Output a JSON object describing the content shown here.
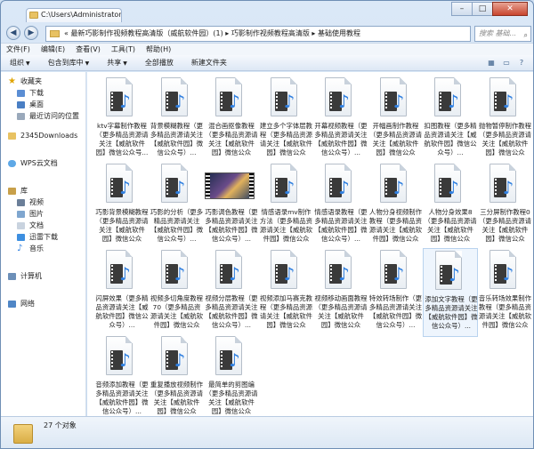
{
  "window": {
    "tab_title": "C:\\Users\\Administrator\\",
    "controls": [
      "–",
      "□",
      "✕"
    ]
  },
  "address": {
    "path": "« 最新巧影制作视频教程高清版（威航软件园）(1) ▸ 巧影制作视频教程高清版 ▸ 基础使用教程",
    "search_placeholder": "搜索 基础..."
  },
  "menu": [
    "文件(F)",
    "编辑(E)",
    "查看(V)",
    "工具(T)",
    "帮助(H)"
  ],
  "toolbar": {
    "organize": "组织",
    "include": "包含到库中",
    "share": "共享",
    "play_all": "全部播放",
    "new_folder": "新建文件夹"
  },
  "nav": {
    "favorites": {
      "label": "收藏夹",
      "items": [
        "下载",
        "桌面",
        "最近访问的位置"
      ]
    },
    "downloads2345": "2345Downloads",
    "wps": "WPS云文档",
    "library": {
      "label": "库",
      "items": [
        "视频",
        "图片",
        "文档",
        "迅雷下载",
        "音乐"
      ]
    },
    "computer": "计算机",
    "network": "网络"
  },
  "files": [
    {
      "name": "ktv字幕制作教程（更多精品资源请关注【威航软件园】微信公众号...",
      "type": "video"
    },
    {
      "name": "背景模糊教程（更多精品资源请关注【威航软件园】微信公众号）...",
      "type": "video"
    },
    {
      "name": "混合画抠像教程（更多精品资源请关注【威航软件园】微信公众号）...",
      "type": "video"
    },
    {
      "name": "建立多个字体层教程（更多精品资源请关注【威航软件园】微信公众号）...",
      "type": "video"
    },
    {
      "name": "开幕视频教程（更多精品资源请关注【威航软件园】微信公众号）...",
      "type": "video"
    },
    {
      "name": "开幅画制作教程（更多精品资源请关注【威航软件园】微信公众号）...",
      "type": "video"
    },
    {
      "name": "扣图教程（更多精品资源请关注【威航软件园】微信公众号）...",
      "type": "video"
    },
    {
      "name": "抛物暂停制作教程（更多精品资源请关注【威航软件园】微信公众号）...",
      "type": "video"
    },
    {
      "name": "巧影背景模糊教程（更多精品资源请关注【威航软件园】微信公众号）...",
      "type": "video"
    },
    {
      "name": "巧影的分析（更多精品资源请关注【威航软件园】微信公众号）...",
      "type": "video"
    },
    {
      "name": "巧影调色教程（更多精品资源请关注【威航软件园】微信公众号）...",
      "type": "image"
    },
    {
      "name": "情感语录mv制作方法（更多精品资源请关注【威航软件园】微信公众号）...",
      "type": "video"
    },
    {
      "name": "情感语录教程（更多精品资源请关注【威航软件园】微信公众号）...",
      "type": "video"
    },
    {
      "name": "人物分身视频制作教程（更多精品资源请关注【威航软件园】微信公众号）...",
      "type": "video"
    },
    {
      "name": "人物分身效果8（更多精品资源请关注【威航软件园】微信公众号）...",
      "type": "video"
    },
    {
      "name": "三分屏制作教程0（更多精品资源请关注【威航软件园】微信公众号）...",
      "type": "video"
    },
    {
      "name": "闪屏效果（更多精品资源请关注【威航软件园】微信公众号）...",
      "type": "video"
    },
    {
      "name": "视频多切角度教程70（更多精品资源请关注【威航软件园】微信公众号）...",
      "type": "video"
    },
    {
      "name": "视频分层教程（更多精品资源请关注【威航软件园】微信公众号）...",
      "type": "video"
    },
    {
      "name": "视频添加马赛克教程（更多精品资源请关注【威航软件园】微信公众号）...",
      "type": "video"
    },
    {
      "name": "视频移动画面教程（更多精品资源请关注【威航软件园】微信公众号）...",
      "type": "video"
    },
    {
      "name": "特效转场制作（更多精品资源请关注【威航软件园】微信公众号）...",
      "type": "video"
    },
    {
      "name": "添加文字教程（更多精品资源请关注【威航软件园】微信公众号）...",
      "type": "video"
    },
    {
      "name": "音乐转场效果制作教程（更多精品资源请关注【威航软件园】微信公众号）...",
      "type": "video"
    },
    {
      "name": "音频添加教程（更多精品资源请关注【威航软件园】微信公众号）...",
      "type": "video"
    },
    {
      "name": "重复播放视频制作（更多精品资源请关注【威航软件园】微信公众号）...",
      "type": "video"
    },
    {
      "name": "最简单的剪图编（更多精品资源请关注【威航软件园】微信公众号）...",
      "type": "video"
    }
  ],
  "selected_index": 22,
  "status": {
    "count": "27 个对象"
  },
  "colors": {
    "folder": "#e8c262",
    "music_note": "#2f7fe0",
    "selection": "#eef5fd"
  }
}
